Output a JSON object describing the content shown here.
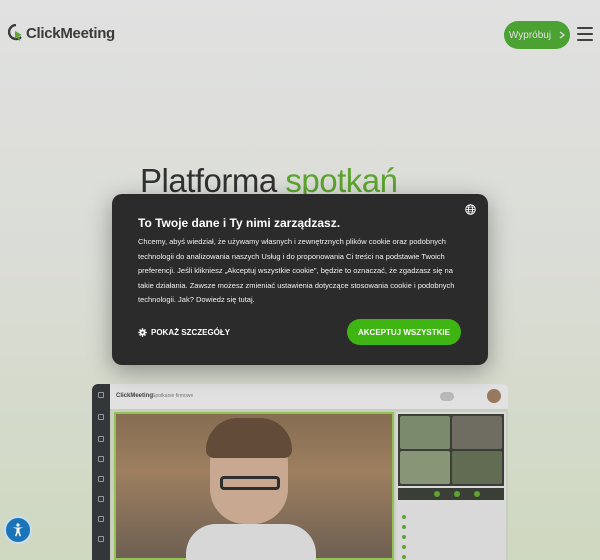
{
  "header": {
    "logo_text": "ClickMeeting",
    "try_button_label": "Wypróbuj",
    "try_button_icon": "chevron-right-icon",
    "menu_icon": "hamburger-menu-icon"
  },
  "hero": {
    "title_main": "Platforma",
    "title_accent": "spotkań"
  },
  "preview": {
    "brand": "ClickMeeting",
    "room": "Spotkanie firmowe"
  },
  "cookie_banner": {
    "title": "To Twoje dane i Ty nimi zarządzasz.",
    "body": "Chcemy, abyś wiedział, że używamy własnych i zewnętrznych plików cookie oraz podobnych technologii do analizowania naszych Usług i do proponowania Ci treści na podstawie Twoich preferencji. Jeśli klikniesz „Akceptuj wszystkie cookie\", będzie to oznaczać, że zgadzasz się na takie działania. Zawsze możesz zmieniać ustawienia dotyczące stosowania cookie i podobnych technologii. Jak? Dowiedz się tutaj.",
    "details_label": "POKAŻ SZCZEGÓŁY",
    "accept_label": "AKCEPTUJ WSZYSTKIE",
    "language_icon": "globe-icon"
  },
  "accessibility": {
    "icon": "accessibility-icon"
  },
  "colors": {
    "brand_green": "#3fb513",
    "dialog_bg": "#2b2b2b",
    "a11y_blue": "#1b73b8"
  }
}
